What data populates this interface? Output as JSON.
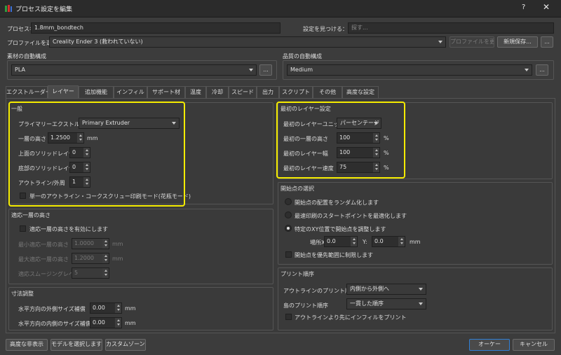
{
  "window": {
    "title": "プロセス設定を編集",
    "help": "?",
    "close": "✕",
    "logo_colors": [
      "#2e9e3e",
      "#d62f2f",
      "#3d6fd6"
    ]
  },
  "top": {
    "process_name_label": "プロセス名",
    "process_name_value": "1.8mm_bondtech",
    "find_label": "設定を見つける：",
    "find_placeholder": "探す...",
    "profile_label": "プロファイルを選択",
    "profile_value": "Creality Ender 3 (救われていない)",
    "update_profile": "プロファイルを更新",
    "save_new": "新規保存...",
    "more": "..."
  },
  "material": {
    "label": "素材の自動構成",
    "value": "PLA",
    "more": "..."
  },
  "quality": {
    "label": "品質の自動構成",
    "value": "Medium",
    "more": "..."
  },
  "tabs": [
    "エクストルーダー",
    "レイヤー",
    "追加機能",
    "インフィル",
    "サポート材",
    "温度",
    "冷却",
    "スピード",
    "出力",
    "スクリプト",
    "その他",
    "高度な設定"
  ],
  "general": {
    "title": "一般",
    "primary_extruder_label": "プライマリーエクストルーダー",
    "primary_extruder_value": "Primary Extruder",
    "layer_height_label": "一層の高さ",
    "layer_height_value": "1.2500",
    "layer_height_unit": "mm",
    "top_solid_label": "上面のソリッドレイヤー",
    "top_solid_value": "0",
    "bottom_solid_label": "底部のソリッドレイヤー",
    "bottom_solid_value": "0",
    "perimeters_label": "アウトライン/外周",
    "perimeters_value": "1",
    "vase_mode_label": "単一のアウトライン・コークスクリュー印刷モード(花瓶モード)"
  },
  "adaptive": {
    "title": "適応一層の高さ",
    "enable_label": "適応一層の高さを有効にします",
    "min_label": "最小適応一層の高さ",
    "min_value": "1.0000",
    "min_unit": "mm",
    "max_label": "最大適応一層の高さ",
    "max_value": "1.2000",
    "max_unit": "mm",
    "smooth_label": "適応スムージングレベル",
    "smooth_value": "5"
  },
  "dimension": {
    "title": "寸法調整",
    "outer_label": "水平方向の外側サイズ補償",
    "outer_value": "0.00",
    "outer_unit": "mm",
    "inner_label": "水平方向の内側のサイズ補償",
    "inner_value": "0.00",
    "inner_unit": "mm"
  },
  "first_layer": {
    "title": "最初のレイヤー設定",
    "unit_label": "最初のレイヤーユニット",
    "unit_value": "パーセンテージ",
    "height_label": "最初の一層の高さ",
    "height_value": "100",
    "height_unit": "%",
    "width_label": "最初のレイヤー幅",
    "width_value": "100",
    "width_unit": "%",
    "speed_label": "最初のレイヤー速度",
    "speed_value": "75",
    "speed_unit": "%"
  },
  "start_point": {
    "title": "開始点の選択",
    "random_label": "開始点の配置をランダム化します",
    "optimize_label": "最速印刷のスタートポイントを最適化します",
    "specific_label": "特定のXY位置で開始点を調整します",
    "x_label": "場所X：",
    "x_value": "0.0",
    "y_label": "Y:",
    "y_value": "0.0",
    "xy_unit": "mm",
    "limit_label": "開始点を優先範囲に制限します"
  },
  "print_order": {
    "title": "プリント順序",
    "outline_label": "アウトラインのプリント順序",
    "outline_value": "内側から外側へ",
    "island_label": "島のプリント順序",
    "island_value": "一貫した順序",
    "infill_first_label": "アウトラインより先にインフィルをプリント"
  },
  "footer": {
    "hide_advanced": "高度な非表示",
    "select_model": "モデルを選択します...",
    "custom_zone": "カスタムゾーン...",
    "ok": "オーケー",
    "cancel": "キャンセル"
  },
  "colors": {
    "highlight": "#f5ec00",
    "primary_border": "#2f7fd5"
  }
}
